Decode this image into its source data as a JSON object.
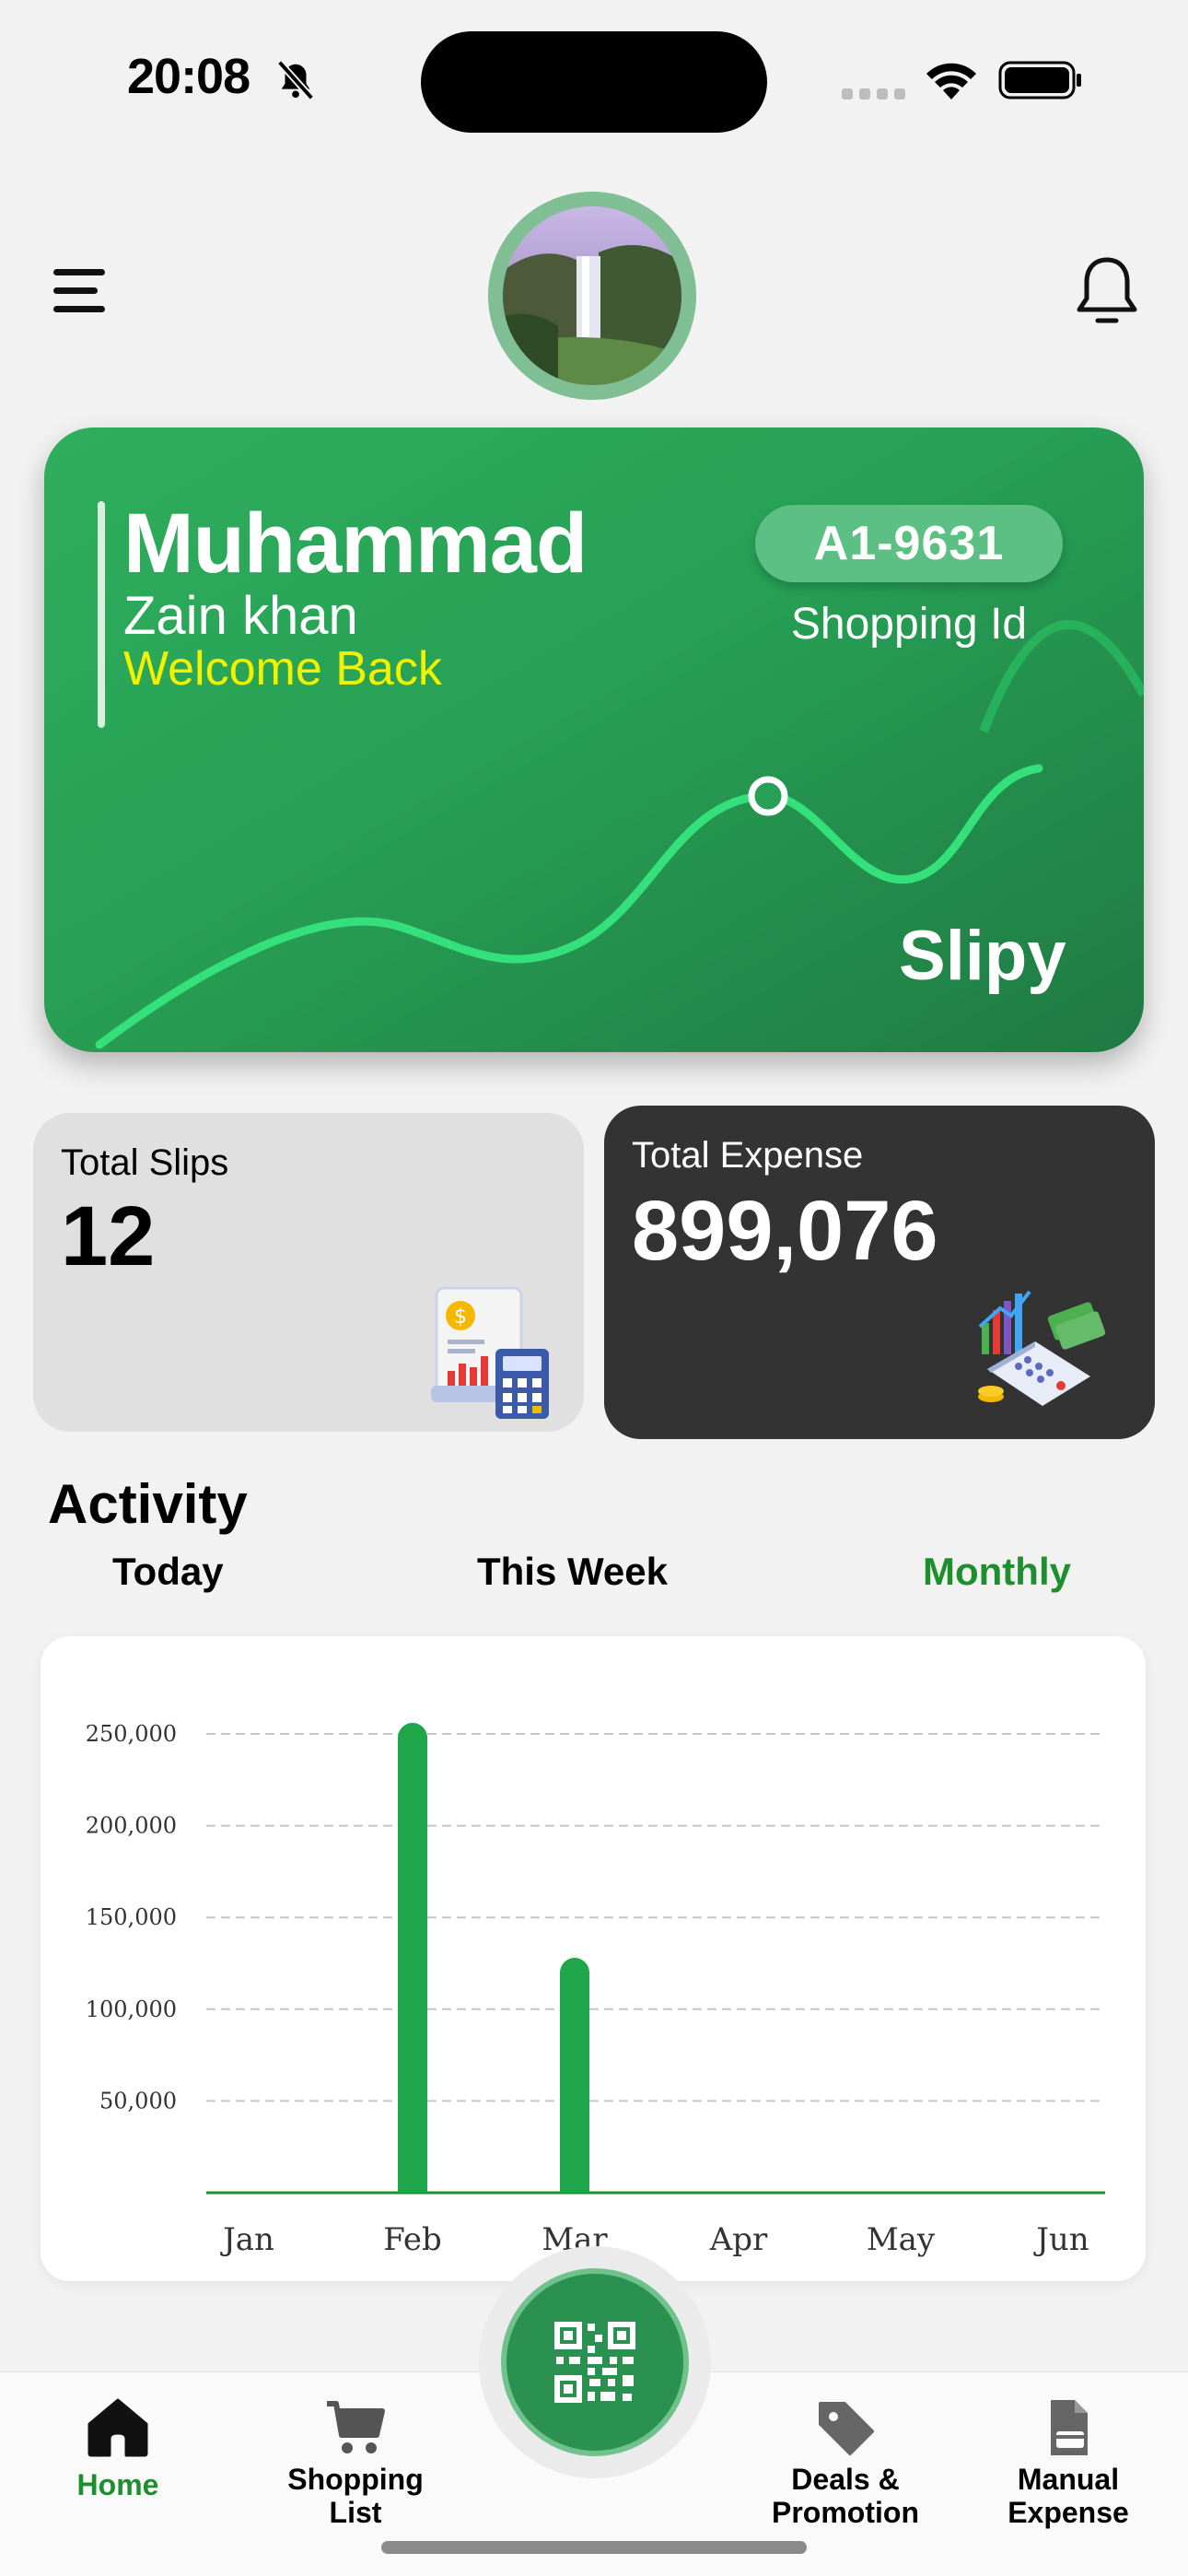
{
  "status_bar": {
    "time": "20:08"
  },
  "header": {
    "menu_icon": "hamburger-icon",
    "avatar": "profile-avatar-waterfall",
    "bell_icon": "bell-icon"
  },
  "hero": {
    "first_name": "Muhammad",
    "last_name": "Zain khan",
    "welcome": "Welcome Back",
    "shopping_id": "A1-9631",
    "shopping_id_label": "Shopping Id",
    "brand": "Slipy",
    "colors": {
      "card": "#27a055",
      "welcome": "#f2f200",
      "wave": "#34e07a"
    }
  },
  "stats": {
    "slips_label": "Total Slips",
    "slips_value": "12",
    "expense_label": "Total Expense",
    "expense_value": "899,076"
  },
  "activity": {
    "title": "Activity",
    "tabs": [
      "Today",
      "This Week",
      "Monthly"
    ],
    "active_tab": "Monthly",
    "accent": "#1e8f2e"
  },
  "chart_data": {
    "type": "bar",
    "categories": [
      "Jan",
      "Feb",
      "Mar",
      "Apr",
      "May",
      "Jun"
    ],
    "values": [
      0,
      256000,
      128000,
      0,
      0,
      0
    ],
    "yticks": [
      "50,000",
      "100,000",
      "150,000",
      "200,000",
      "250,000"
    ],
    "ylim": [
      0,
      250000
    ],
    "grid": true,
    "bar_color": "#1fa64a"
  },
  "bottom_nav": {
    "home": "Home",
    "shopping_line1": "Shopping",
    "shopping_line2": "List",
    "deals_line1": "Deals &",
    "deals_line2": "Promotion",
    "manual_line1": "Manual",
    "manual_line2": "Expense",
    "scan_icon": "qr-code-icon"
  }
}
